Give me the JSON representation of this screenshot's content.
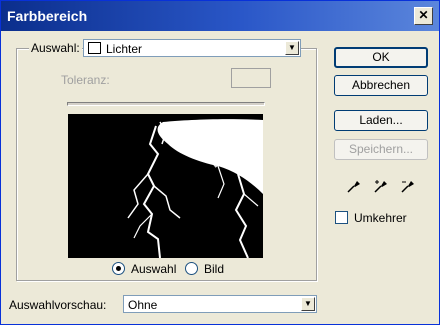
{
  "window": {
    "title": "Farbbereich",
    "close_glyph": "✕"
  },
  "selection": {
    "label": "Auswahl:",
    "value": "Lichter"
  },
  "tolerance": {
    "label": "Toleranz:"
  },
  "preview_mode": {
    "options": [
      {
        "label": "Auswahl",
        "selected": true
      },
      {
        "label": "Bild",
        "selected": false
      }
    ]
  },
  "selection_preview": {
    "label": "Auswahlvorschau:",
    "value": "Ohne"
  },
  "buttons": {
    "ok": "OK",
    "cancel": "Abbrechen",
    "load": "Laden...",
    "save": "Speichern..."
  },
  "tools": [
    "eyedropper-icon",
    "eyedropper-plus-icon",
    "eyedropper-minus-icon"
  ],
  "invert": {
    "label": "Umkehrer",
    "checked": false
  },
  "colors": {
    "title_bar": "#0b2e8c",
    "dialog_bg": "#ece9d8"
  }
}
